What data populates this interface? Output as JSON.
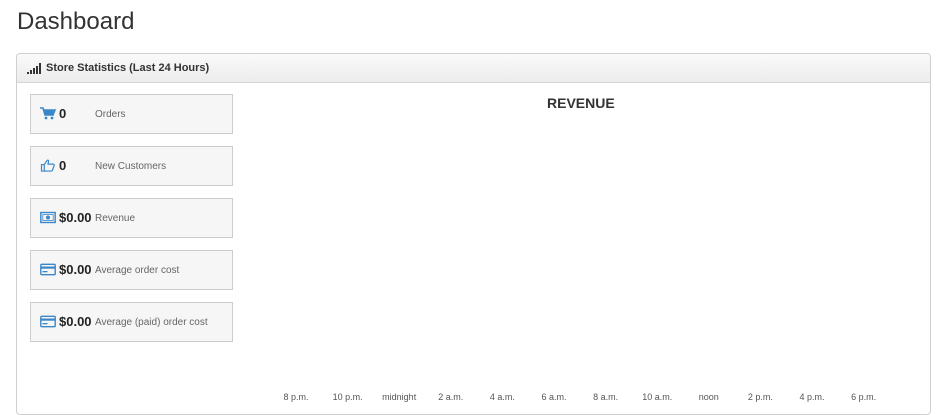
{
  "page": {
    "title": "Dashboard"
  },
  "panel": {
    "title": "Store Statistics (Last 24 Hours)"
  },
  "stats": [
    {
      "icon": "cart-icon",
      "value": "0",
      "label": "Orders"
    },
    {
      "icon": "thumbs-up-icon",
      "value": "0",
      "label": "New Customers"
    },
    {
      "icon": "banknote-icon",
      "value": "$0.00",
      "label": "Revenue"
    },
    {
      "icon": "credit-card-icon",
      "value": "$0.00",
      "label": "Average order cost"
    },
    {
      "icon": "credit-card-icon",
      "value": "$0.00",
      "label": "Average (paid) order cost"
    }
  ],
  "colors": {
    "accent": "#3a87c8"
  },
  "chart_data": {
    "type": "line",
    "title": "REVENUE",
    "x_ticks": [
      "8 p.m.",
      "10 p.m.",
      "midnight",
      "2 a.m.",
      "4 a.m.",
      "6 a.m.",
      "8 a.m.",
      "10 a.m.",
      "noon",
      "2 p.m.",
      "4 p.m.",
      "6 p.m."
    ],
    "series": []
  }
}
